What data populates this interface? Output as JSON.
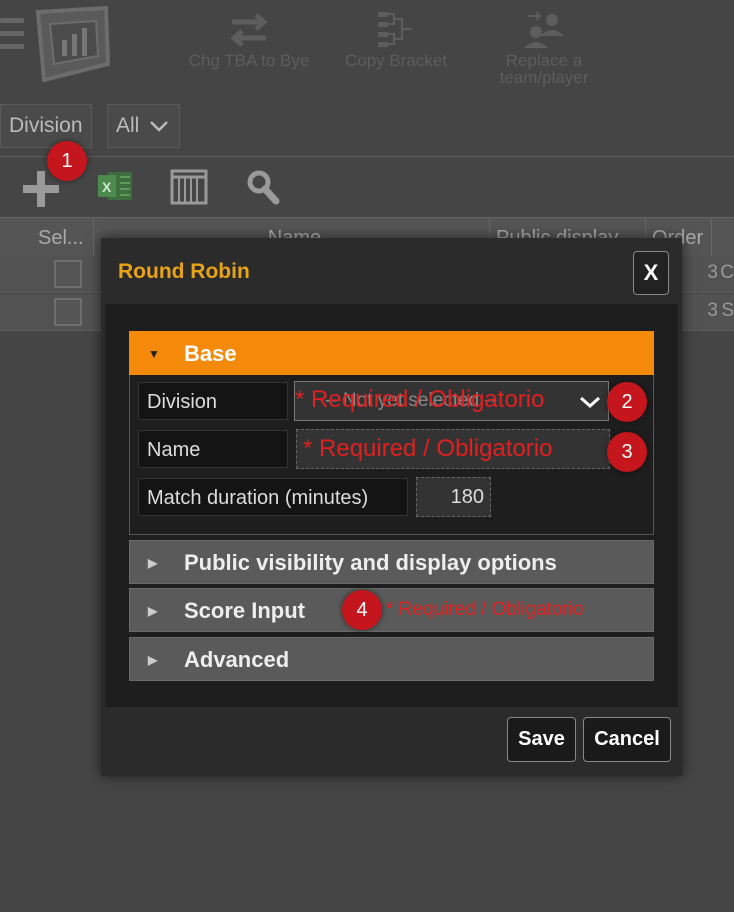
{
  "toolbar_top": {
    "chg_tba_label": "Chg TBA to Bye",
    "copy_bracket_label": "Copy Bracket",
    "replace_label_line1": "Replace a",
    "replace_label_line2": "team/player"
  },
  "filters": {
    "division_label": "Division",
    "all_value": "All"
  },
  "grid": {
    "columns": [
      "Sel...",
      "Name",
      "Public display",
      "Order"
    ],
    "rows": [
      {
        "order": "3",
        "tail": "C"
      },
      {
        "order": "3",
        "tail": "S"
      }
    ]
  },
  "badges": [
    "1",
    "2",
    "3",
    "4"
  ],
  "modal": {
    "title": "Round Robin",
    "close_label": "X",
    "sections": {
      "base": "Base",
      "visibility": "Public visibility and display options",
      "score_input": "Score Input",
      "advanced": "Advanced"
    },
    "fields": {
      "division_label": "Division",
      "division_placeholder": "-- Not yet selected --",
      "name_label": "Name",
      "match_duration_label": "Match duration (minutes)",
      "match_duration_value": "180"
    },
    "required_text": "* Required / Obligatorio",
    "save_label": "Save",
    "cancel_label": "Cancel"
  },
  "colors": {
    "accent_orange": "#f58a0a",
    "title_gold": "#e8a317",
    "required_red": "#e02020",
    "badge_red": "#c4161c"
  }
}
